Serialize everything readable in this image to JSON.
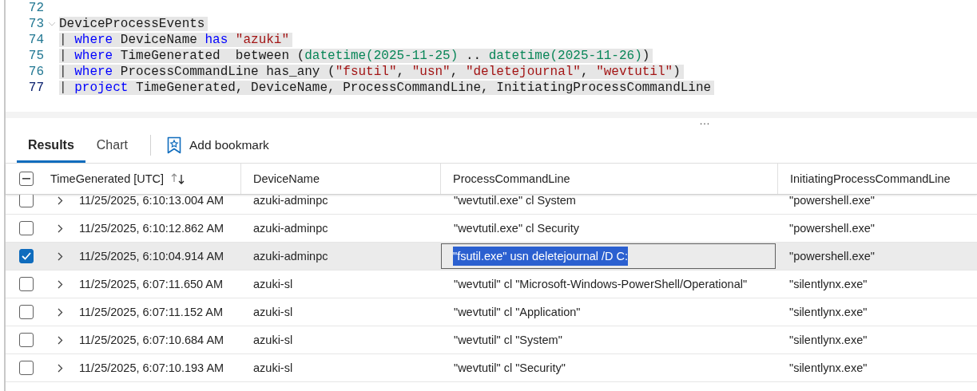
{
  "editor": {
    "lines": [
      {
        "number": "72",
        "current": false
      },
      {
        "number": "73",
        "highlighted": true,
        "current": false,
        "tokens": [
          {
            "kind": "plain",
            "text": "DeviceProcessEvents"
          }
        ]
      },
      {
        "number": "74",
        "highlighted": true,
        "current": false,
        "tokens": [
          {
            "kind": "pipe",
            "text": "| "
          },
          {
            "kind": "keyword",
            "text": "where"
          },
          {
            "kind": "plain",
            "text": " DeviceName "
          },
          {
            "kind": "keyword",
            "text": "has "
          },
          {
            "kind": "string",
            "text": "\"azuki\""
          }
        ]
      },
      {
        "number": "75",
        "highlighted": true,
        "current": false,
        "tokens": [
          {
            "kind": "pipe",
            "text": "| "
          },
          {
            "kind": "keyword",
            "text": "where"
          },
          {
            "kind": "plain",
            "text": " TimeGenerated  between ("
          },
          {
            "kind": "func",
            "text": "datetime(2025-11-25)"
          },
          {
            "kind": "plain",
            "text": " .. "
          },
          {
            "kind": "func",
            "text": "datetime(2025-11-26)"
          },
          {
            "kind": "plain",
            "text": ")"
          }
        ]
      },
      {
        "number": "76",
        "highlighted": true,
        "current": false,
        "tokens": [
          {
            "kind": "pipe",
            "text": "| "
          },
          {
            "kind": "keyword",
            "text": "where"
          },
          {
            "kind": "plain",
            "text": " ProcessCommandLine has_any ("
          },
          {
            "kind": "string",
            "text": "\"fsutil\""
          },
          {
            "kind": "plain",
            "text": ", "
          },
          {
            "kind": "string",
            "text": "\"usn\""
          },
          {
            "kind": "plain",
            "text": ", "
          },
          {
            "kind": "string",
            "text": "\"deletejournal\""
          },
          {
            "kind": "plain",
            "text": ", "
          },
          {
            "kind": "string",
            "text": "\"wevtutil\""
          },
          {
            "kind": "plain",
            "text": ")"
          }
        ]
      },
      {
        "number": "77",
        "highlighted": true,
        "current": true,
        "tokens": [
          {
            "kind": "pipe",
            "text": "| "
          },
          {
            "kind": "keyword",
            "text": "project"
          },
          {
            "kind": "plain",
            "text": " TimeGenerated, DeviceName, ProcessCommandLine, InitiatingProcessCommandLine"
          }
        ]
      }
    ]
  },
  "splitter": {
    "handle": "…"
  },
  "tabs": [
    {
      "label": "Results",
      "selected": true
    },
    {
      "label": "Chart",
      "selected": false
    }
  ],
  "bookmark_button": {
    "label": "Add bookmark"
  },
  "table": {
    "header_checkbox": {
      "indeterminate": true
    },
    "columns": [
      "TimeGenerated [UTC]",
      "DeviceName",
      "ProcessCommandLine",
      "InitiatingProcessCommandLine"
    ],
    "rows": [
      {
        "selected": false,
        "command_selected": false,
        "cells": [
          "11/25/2025, 6:10:13.004 AM",
          "azuki-adminpc",
          "\"wevtutil.exe\" cl System",
          "\"powershell.exe\""
        ]
      },
      {
        "selected": false,
        "command_selected": false,
        "cells": [
          "11/25/2025, 6:10:12.862 AM",
          "azuki-adminpc",
          "\"wevtutil.exe\" cl Security",
          "\"powershell.exe\""
        ]
      },
      {
        "selected": true,
        "command_selected": true,
        "cells": [
          "11/25/2025, 6:10:04.914 AM",
          "azuki-adminpc",
          "\"fsutil.exe\" usn deletejournal /D C:",
          "\"powershell.exe\""
        ]
      },
      {
        "selected": false,
        "command_selected": false,
        "cells": [
          "11/25/2025, 6:07:11.650 AM",
          "azuki-sl",
          "\"wevtutil\" cl \"Microsoft-Windows-PowerShell/Operational\"",
          "\"silentlynx.exe\""
        ]
      },
      {
        "selected": false,
        "command_selected": false,
        "cells": [
          "11/25/2025, 6:07:11.152 AM",
          "azuki-sl",
          "\"wevtutil\" cl \"Application\"",
          "\"silentlynx.exe\""
        ]
      },
      {
        "selected": false,
        "command_selected": false,
        "cells": [
          "11/25/2025, 6:07:10.684 AM",
          "azuki-sl",
          "\"wevtutil\" cl \"System\"",
          "\"silentlynx.exe\""
        ]
      },
      {
        "selected": false,
        "command_selected": false,
        "cells": [
          "11/25/2025, 6:07:10.193 AM",
          "azuki-sl",
          "\"wevtutil\" cl \"Security\"",
          "\"silentlynx.exe\""
        ]
      }
    ]
  }
}
